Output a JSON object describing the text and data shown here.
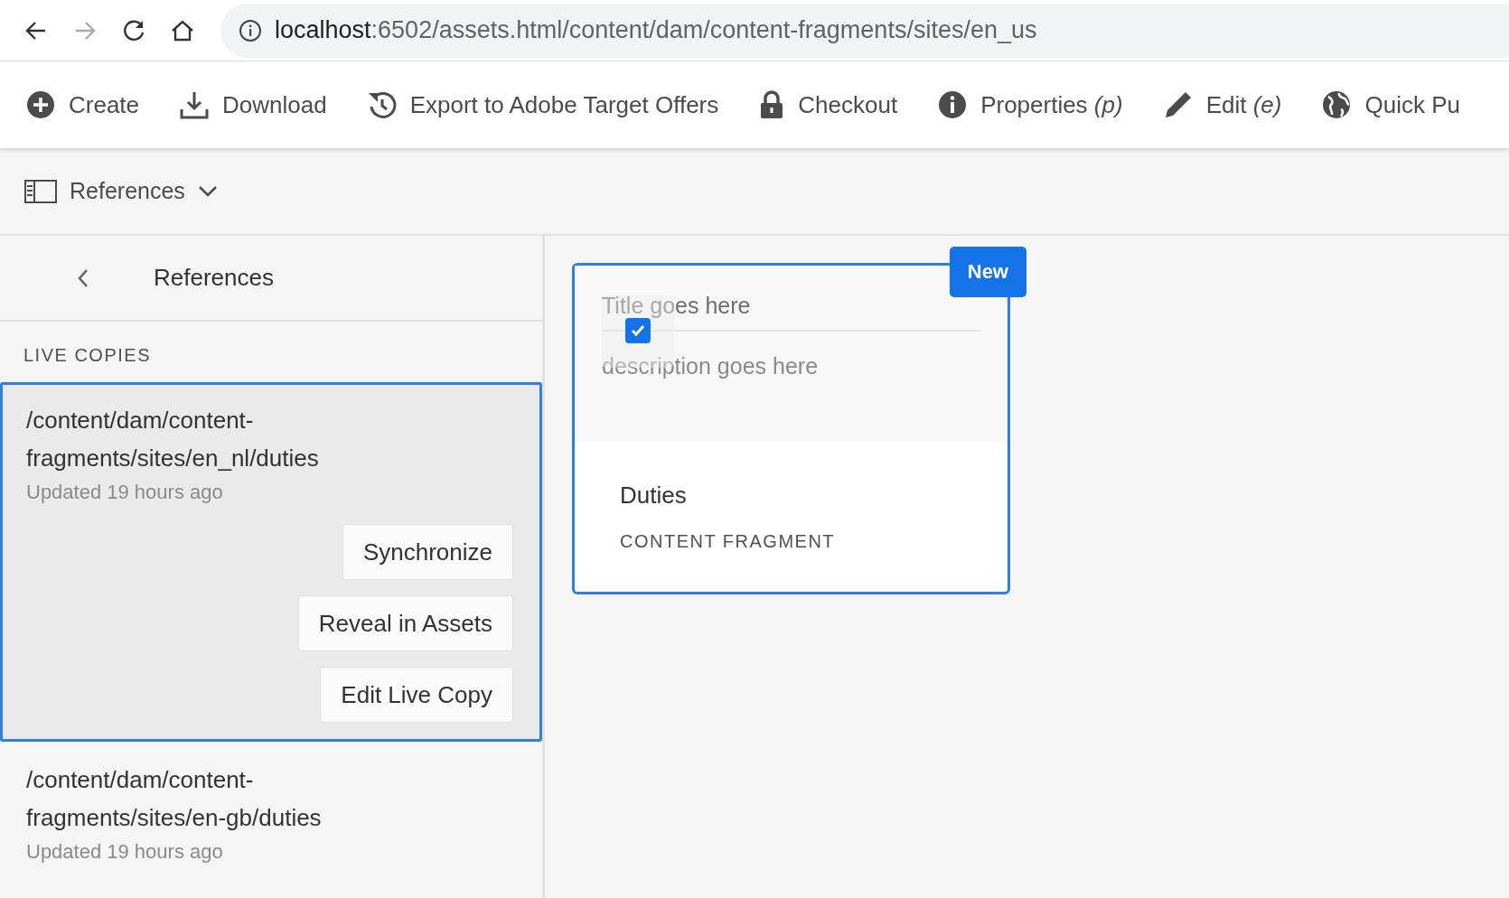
{
  "browser": {
    "nav": [
      {
        "kind": "back",
        "disabled": false
      },
      {
        "kind": "forward",
        "disabled": true
      },
      {
        "kind": "reload",
        "disabled": false
      },
      {
        "kind": "home",
        "disabled": false
      }
    ],
    "address": {
      "host": "localhost",
      "path": ":6502/assets.html/content/dam/content-fragments/sites/en_us"
    }
  },
  "toolbar": [
    {
      "kind": "plus",
      "label": "Create"
    },
    {
      "kind": "download",
      "label": "Download"
    },
    {
      "kind": "export",
      "label": "Export to Adobe Target Offers"
    },
    {
      "kind": "lock",
      "label": "Checkout"
    },
    {
      "kind": "info",
      "label": "Properties *(p)*"
    },
    {
      "kind": "pencil",
      "label": "Edit *(e)*"
    },
    {
      "kind": "globe",
      "label": "Quick Pu"
    }
  ],
  "rail": {
    "label": "References"
  },
  "panel": {
    "title": "References",
    "section": "LIVE COPIES",
    "items": [
      {
        "path": "/content/dam/content-fragments/sites/en_nl/duties",
        "updated": "Updated 19 hours ago",
        "selected": true,
        "actions": [
          "Synchronize",
          "Reveal in Assets",
          "Edit Live Copy"
        ]
      },
      {
        "path": "/content/dam/content-fragments/sites/en-gb/duties",
        "updated": "Updated 19 hours ago",
        "selected": false
      }
    ]
  },
  "card": {
    "selected": true,
    "checked": true,
    "badge": "New",
    "title_placeholder": "Title goes here",
    "description_placeholder": "description goes here",
    "name": "Duties",
    "type": "CONTENT FRAGMENT"
  }
}
